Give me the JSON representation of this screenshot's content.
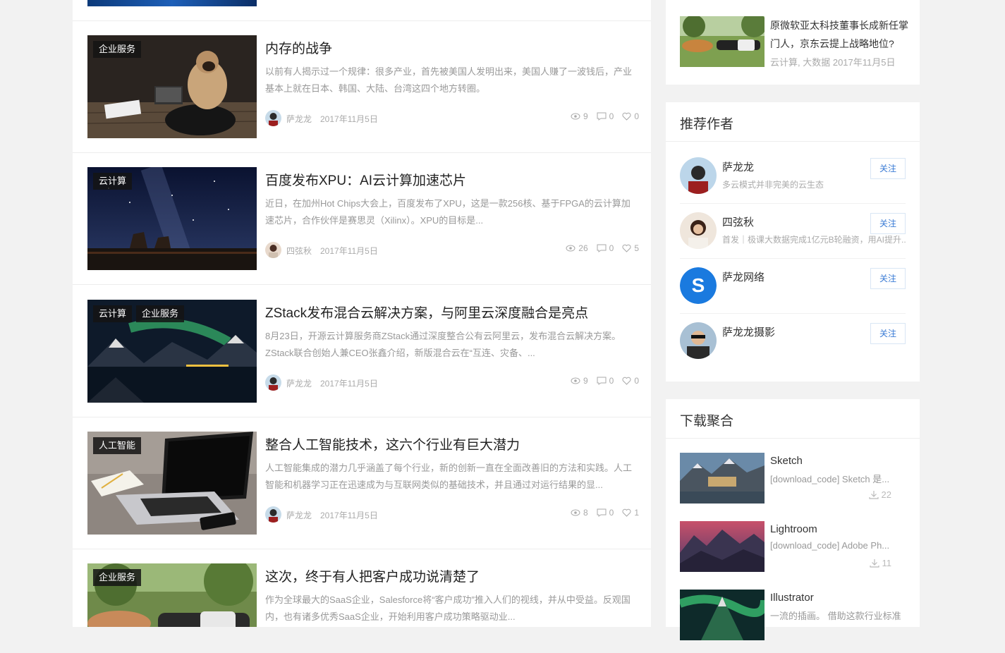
{
  "articles": [
    {
      "tags": [
        "企业服务"
      ],
      "title": "内存的战争",
      "excerpt": "以前有人揭示过一个规律：很多产业，首先被美国人发明出来，美国人赚了一波钱后，产业基本上就在日本、韩国、大陆、台湾这四个地方转圈。",
      "author": "萨龙龙",
      "date": "2017年11月5日",
      "views": "9",
      "comments": "0",
      "likes": "0"
    },
    {
      "tags": [
        "云计算"
      ],
      "title": "百度发布XPU：AI云计算加速芯片",
      "excerpt": "近日，在加州Hot Chips大会上，百度发布了XPU，这是一款256核、基于FPGA的云计算加速芯片，合作伙伴是赛思灵（Xilinx）。XPU的目标是...",
      "author": "四弦秋",
      "date": "2017年11月5日",
      "views": "26",
      "comments": "0",
      "likes": "5"
    },
    {
      "tags": [
        "云计算",
        "企业服务"
      ],
      "title": "ZStack发布混合云解决方案，与阿里云深度融合是亮点",
      "excerpt": "8月23日，开源云计算服务商ZStack通过深度整合公有云阿里云，发布混合云解决方案。ZStack联合创始人兼CEO张鑫介绍，新版混合云在“互连、灾备、...",
      "author": "萨龙龙",
      "date": "2017年11月5日",
      "views": "9",
      "comments": "0",
      "likes": "0"
    },
    {
      "tags": [
        "人工智能"
      ],
      "title": "整合人工智能技术，这六个行业有巨大潜力",
      "excerpt": "人工智能集成的潜力几乎涵盖了每个行业，新的创新一直在全面改善旧的方法和实践。人工智能和机器学习正在迅速成为与互联网类似的基础技术，并且通过对运行结果的显...",
      "author": "萨龙龙",
      "date": "2017年11月5日",
      "views": "8",
      "comments": "0",
      "likes": "1"
    },
    {
      "tags": [
        "企业服务"
      ],
      "title": "这次，终于有人把客户成功说清楚了",
      "excerpt": "作为全球最大的SaaS企业，Salesforce将“客户成功”推入人们的视线，并从中受益。反观国内，也有诸多优秀SaaS企业，开始利用客户成功策略驱动业...",
      "author": "",
      "date": "",
      "views": "",
      "comments": "",
      "likes": ""
    }
  ],
  "sidebar": {
    "news": {
      "title": "原微软亚太科技董事长成新任掌门人，京东云提上战略地位?",
      "meta": "云计算, 大数据   2017年11月5日"
    },
    "authors": {
      "title": "推荐作者",
      "follow_label": "关注",
      "items": [
        {
          "name": "萨龙龙",
          "desc": "多云模式并非完美的云生态"
        },
        {
          "name": "四弦秋",
          "desc": "首发｜极课大数据完成1亿元B轮融资，用AI提升..."
        },
        {
          "name": "萨龙网络",
          "desc": ""
        },
        {
          "name": "萨龙龙摄影",
          "desc": ""
        }
      ]
    },
    "downloads": {
      "title": "下载聚合",
      "items": [
        {
          "name": "Sketch",
          "desc": "[download_code] Sketch 是...",
          "count": "22"
        },
        {
          "name": "Lightroom",
          "desc": "[download_code] Adobe Ph...",
          "count": "11"
        },
        {
          "name": "Illustrator",
          "desc": "一流的插画。 借助这款行业标准",
          "count": ""
        }
      ]
    }
  }
}
